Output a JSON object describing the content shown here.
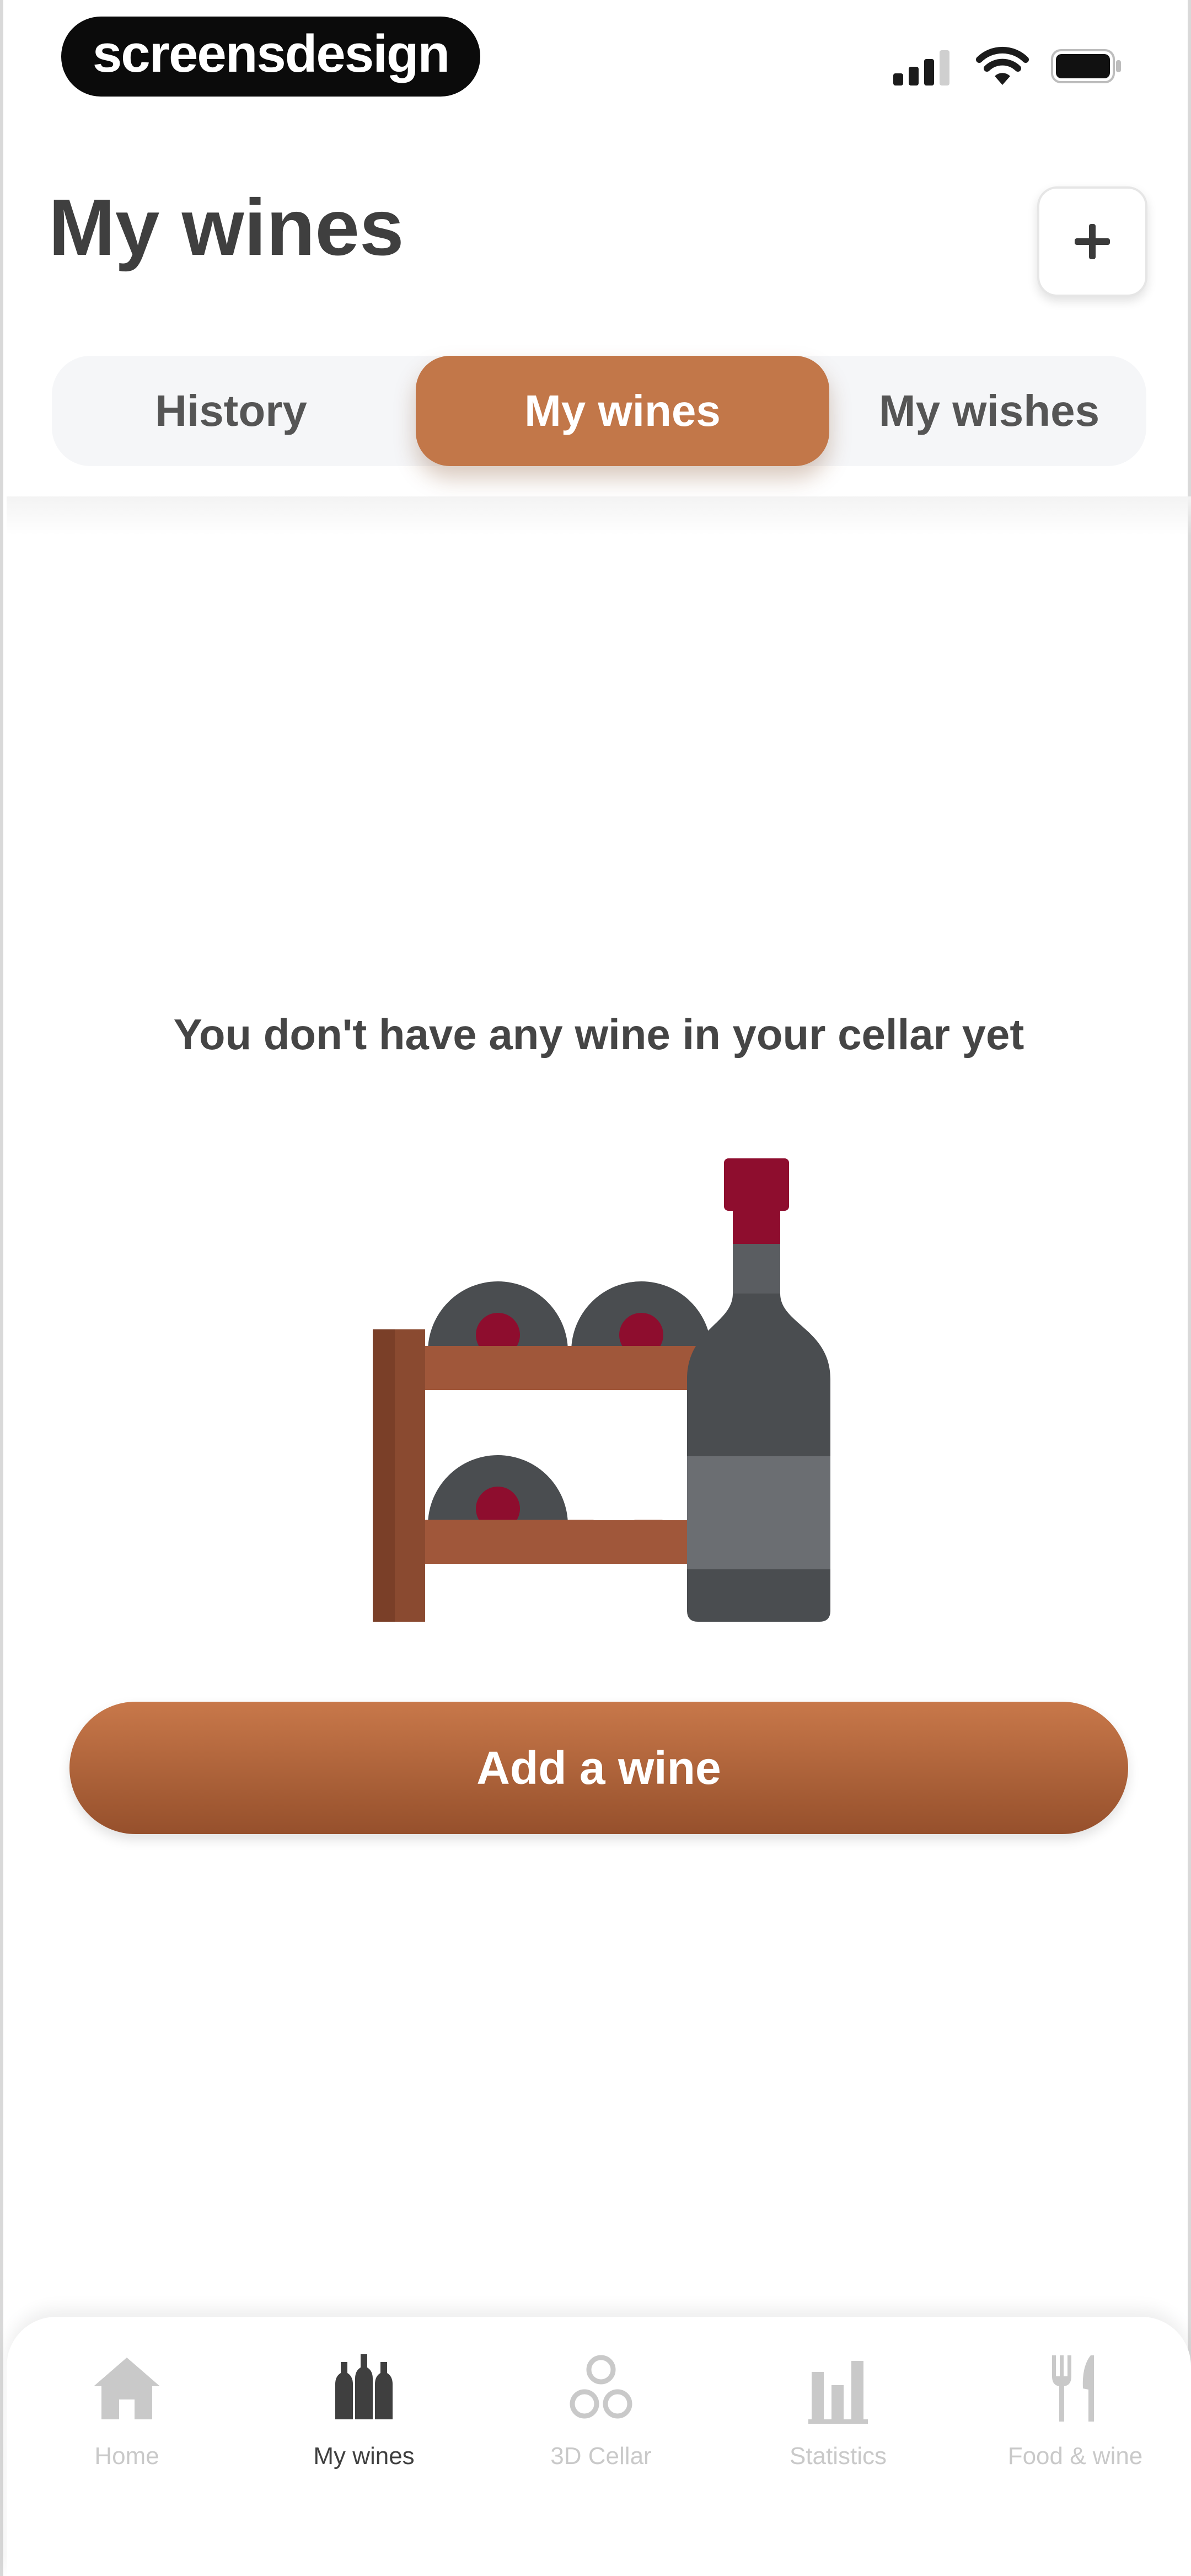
{
  "status_bar": {
    "watermark": "screensdesign"
  },
  "header": {
    "title": "My wines",
    "add_button_label": "+"
  },
  "tabs": [
    {
      "label": "History",
      "active": false
    },
    {
      "label": "My wines",
      "active": true
    },
    {
      "label": "My wishes",
      "active": false
    }
  ],
  "empty_state": {
    "message": "You don't have any wine in your cellar yet",
    "illustration": "wine-rack-with-bottle-icon",
    "button_label": "Add a wine"
  },
  "bottom_nav": [
    {
      "label": "Home",
      "icon": "home-icon",
      "active": false
    },
    {
      "label": "My wines",
      "icon": "bottles-icon",
      "active": true
    },
    {
      "label": "3D Cellar",
      "icon": "cellar-icon",
      "active": false
    },
    {
      "label": "Statistics",
      "icon": "bar-chart-icon",
      "active": false
    },
    {
      "label": "Food & wine",
      "icon": "fork-knife-icon",
      "active": false
    }
  ],
  "colors": {
    "accent": "#c27749",
    "accent_dark": "#96502c",
    "wine_red": "#8e0d2e",
    "bottle_gray": "#4a4d50",
    "text": "#3f3f3f",
    "inactive": "#c9c9c9"
  }
}
